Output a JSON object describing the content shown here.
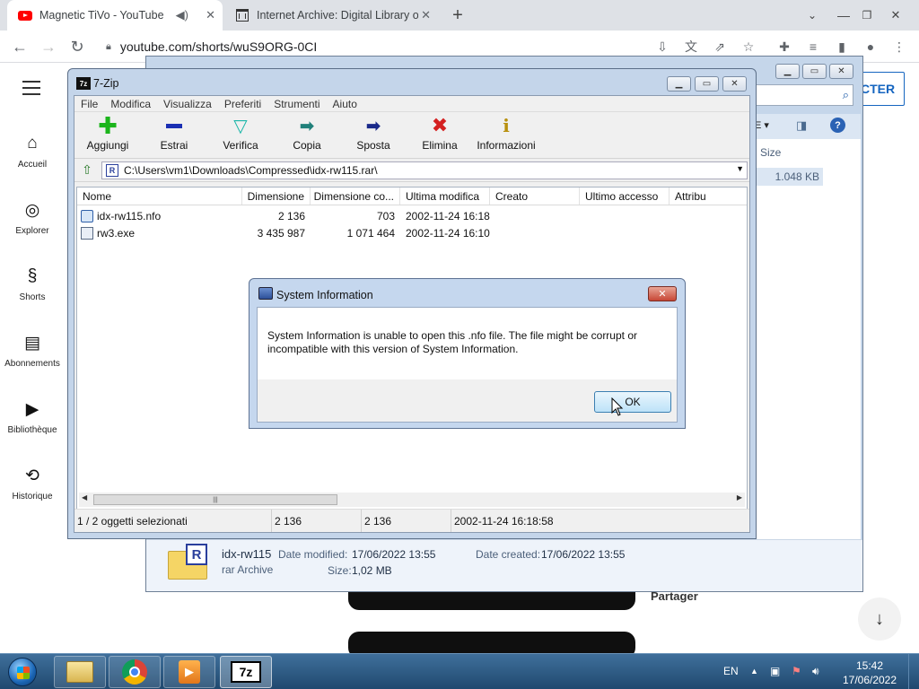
{
  "browser": {
    "tabs": [
      {
        "title": "Magnetic TiVo - YouTube",
        "icon": "youtube-icon",
        "active": true
      },
      {
        "title": "Internet Archive: Digital Library o",
        "icon": "internet-archive-icon",
        "active": false
      }
    ],
    "url": "youtube.com/shorts/wuS9ORG-0CI"
  },
  "youtube": {
    "nav": [
      {
        "label": "Accueil",
        "icon": "home-icon"
      },
      {
        "label": "Explorer",
        "icon": "compass-icon"
      },
      {
        "label": "Shorts",
        "icon": "shorts-icon"
      },
      {
        "label": "Abonnements",
        "icon": "subscriptions-icon"
      },
      {
        "label": "Bibliothèque",
        "icon": "library-icon"
      },
      {
        "label": "Historique",
        "icon": "history-icon"
      }
    ],
    "connect_label": "CTER",
    "share_label": "Partager"
  },
  "explorer": {
    "column_size": "Size",
    "size_value": "1.048 KB",
    "details": {
      "name": "idx-rw115",
      "type": "rar Archive",
      "modified_label": "Date modified:",
      "modified_value": "17/06/2022 13:55",
      "created_label": "Date created:",
      "created_value": "17/06/2022 13:55",
      "size_label": "Size:",
      "size_value": "1,02 MB"
    }
  },
  "sevenzip": {
    "title": "7-Zip",
    "menu": [
      "File",
      "Modifica",
      "Visualizza",
      "Preferiti",
      "Strumenti",
      "Aiuto"
    ],
    "toolbar": [
      {
        "label": "Aggiungi",
        "icon": "add-icon"
      },
      {
        "label": "Estrai",
        "icon": "extract-icon"
      },
      {
        "label": "Verifica",
        "icon": "test-icon"
      },
      {
        "label": "Copia",
        "icon": "copy-icon"
      },
      {
        "label": "Sposta",
        "icon": "move-icon"
      },
      {
        "label": "Elimina",
        "icon": "delete-icon"
      },
      {
        "label": "Informazioni",
        "icon": "info-icon"
      }
    ],
    "path": "C:\\Users\\vm1\\Downloads\\Compressed\\idx-rw115.rar\\",
    "columns": [
      "Nome",
      "Dimensione",
      "Dimensione co...",
      "Ultima modifica",
      "Creato",
      "Ultimo accesso",
      "Attribu"
    ],
    "files": [
      {
        "name": "idx-rw115.nfo",
        "size": "2 136",
        "packed": "703",
        "modified": "2002-11-24 16:18"
      },
      {
        "name": "rw3.exe",
        "size": "3 435 987",
        "packed": "1 071 464",
        "modified": "2002-11-24 16:10"
      }
    ],
    "status": {
      "selection": "1 / 2 oggetti selezionati",
      "size": "2 136",
      "packed": "2 136",
      "date": "2002-11-24 16:18:58"
    }
  },
  "dialog": {
    "title": "System Information",
    "message": "System Information is unable to open this .nfo file.  The file might be corrupt or incompatible with this version of System Information.",
    "ok_label": "OK"
  },
  "taskbar": {
    "language": "EN",
    "time": "15:42",
    "date": "17/06/2022"
  }
}
